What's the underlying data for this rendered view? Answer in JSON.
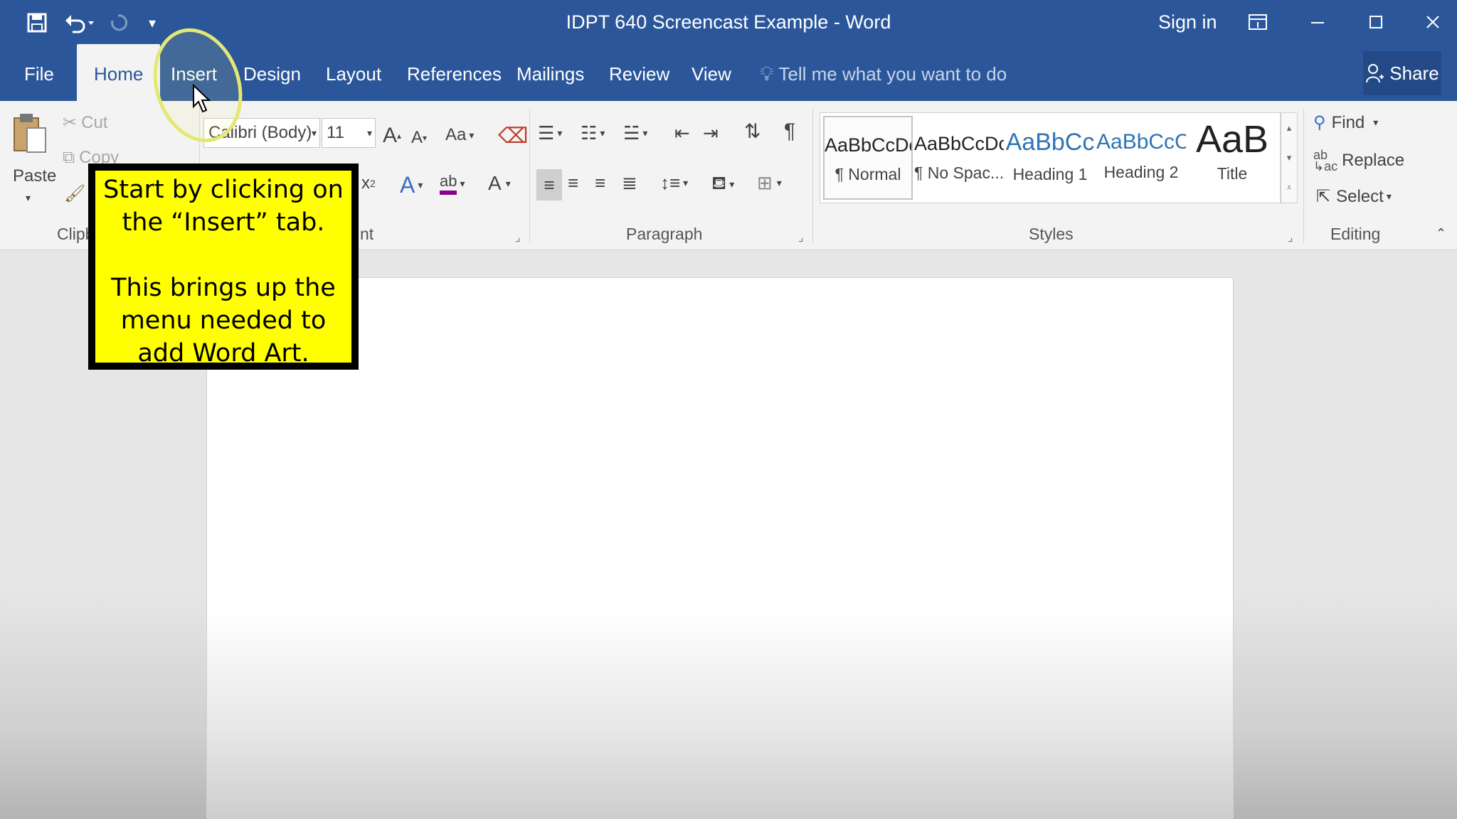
{
  "titlebar": {
    "doc_title": "IDPT 640 Screencast Example  -  Word",
    "sign_in": "Sign in",
    "qat_icons": [
      "save-icon",
      "undo-icon",
      "redo-icon",
      "customize-qat-icon"
    ],
    "window_icons": [
      "ribbon-display-icon",
      "minimize-icon",
      "maximize-icon",
      "close-icon"
    ]
  },
  "tabs": [
    "File",
    "Home",
    "Insert",
    "Design",
    "Layout",
    "References",
    "Mailings",
    "Review",
    "View"
  ],
  "active_tab": "Home",
  "tell_me": "Tell me what you want to do",
  "share": "Share",
  "ribbon": {
    "clipboard": {
      "paste": "Paste",
      "cut": "Cut",
      "copy": "Copy",
      "label": "Clipb"
    },
    "font": {
      "family": "Calibri (Body)",
      "size": "11",
      "grow": "A",
      "shrink": "A",
      "change_case": "Aa",
      "superscript": "x",
      "font_color": "A",
      "label_tail": "nt"
    },
    "paragraph": {
      "label": "Paragraph"
    },
    "styles": {
      "label": "Styles",
      "items": [
        {
          "sample": "AaBbCcDc",
          "name": "¶ Normal"
        },
        {
          "sample": "AaBbCcDc",
          "name": "¶ No Spac..."
        },
        {
          "sample": "AaBbCc",
          "name": "Heading 1"
        },
        {
          "sample": "AaBbCcC",
          "name": "Heading 2"
        },
        {
          "sample": "AaB",
          "name": "Title"
        }
      ]
    },
    "editing": {
      "label": "Editing",
      "find": "Find",
      "replace": "Replace",
      "select": "Select"
    }
  },
  "callout": {
    "line1": "Start by clicking on",
    "line2": "the “Insert” tab.",
    "line3": "This brings up the",
    "line4": "menu needed to",
    "line5": "add Word Art."
  },
  "colors": {
    "word_blue": "#2b579a",
    "ribbon_bg": "#f3f3f3",
    "callout_bg": "#ffff00",
    "highlight_ring": "#e4e873"
  }
}
